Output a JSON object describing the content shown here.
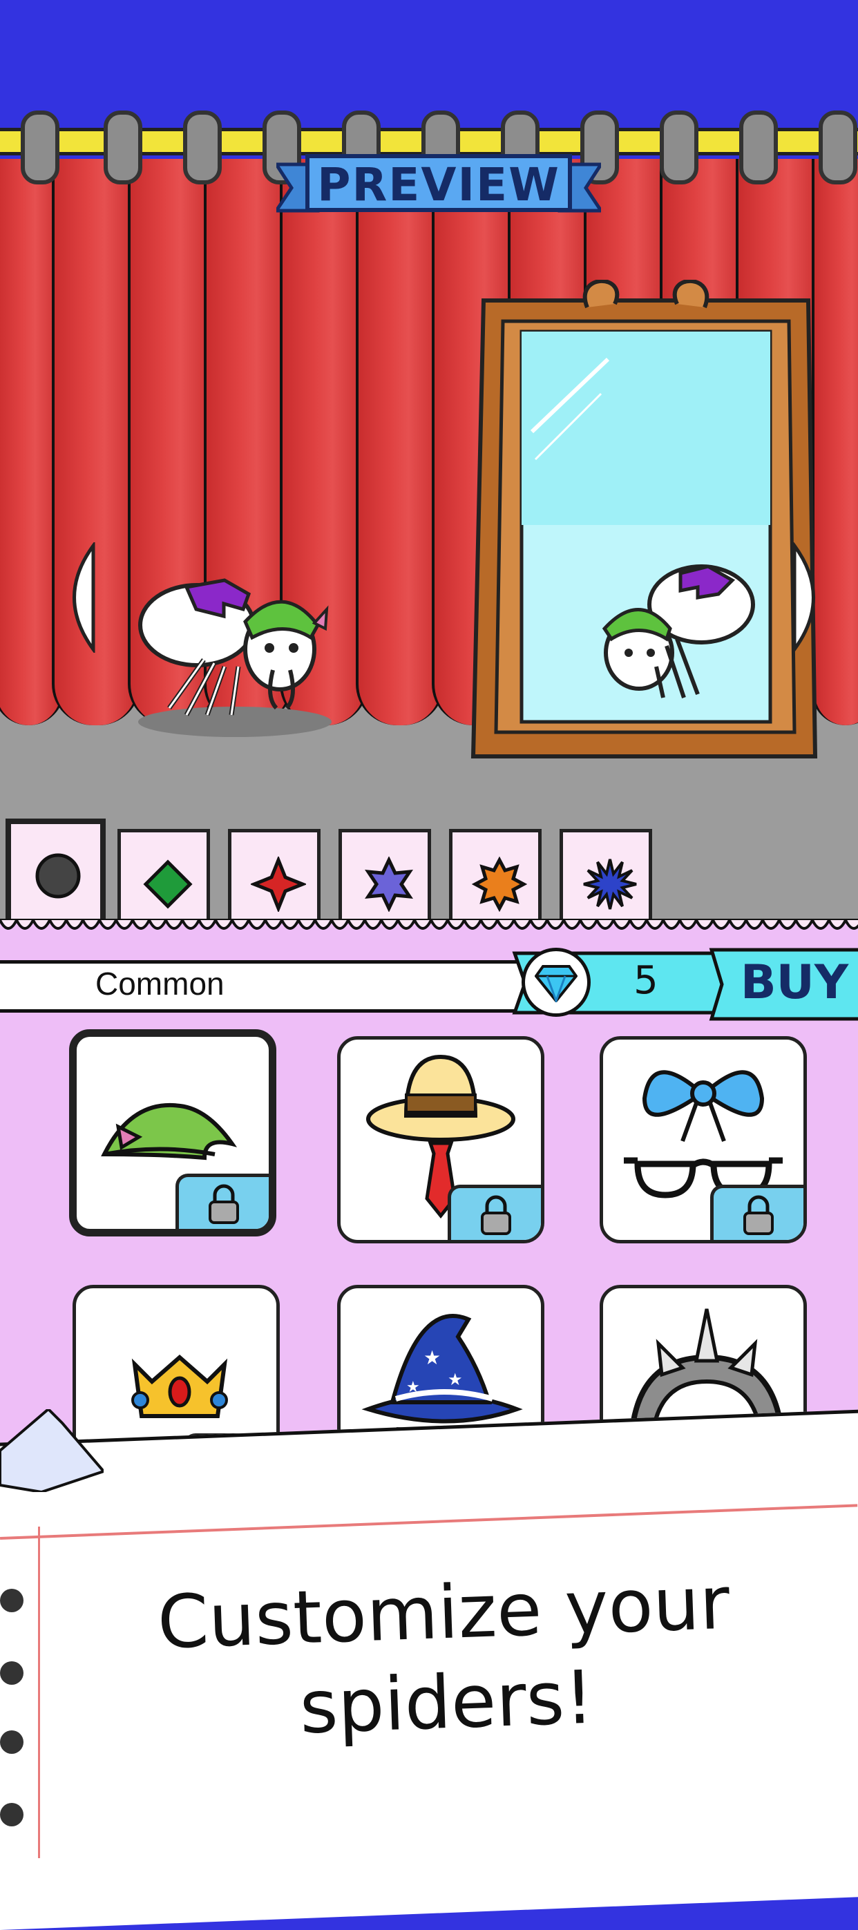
{
  "stage": {
    "banner_label": "PREVIEW",
    "prev_arrow_icon": "chevron-left-icon",
    "next_arrow_icon": "chevron-right-icon",
    "character": "spider-character",
    "mirror": "mirror-frame"
  },
  "rarity_tabs": [
    {
      "name": "common",
      "icon": "circle-icon",
      "color": "#444444"
    },
    {
      "name": "uncommon",
      "icon": "diamond-icon",
      "color": "#1f9b3a"
    },
    {
      "name": "rare",
      "icon": "four-point-star-icon",
      "color": "#d62525"
    },
    {
      "name": "epic",
      "icon": "six-point-star-icon",
      "color": "#6b63d8"
    },
    {
      "name": "legendary",
      "icon": "eight-point-star-icon",
      "color": "#ea7f1c"
    },
    {
      "name": "mythic",
      "icon": "twelve-point-star-icon",
      "color": "#2d43c9"
    }
  ],
  "shop": {
    "rarity_label": "Common",
    "currency_icon": "diamond-gem-icon",
    "price": "5",
    "buy_label": "BUY",
    "items": [
      {
        "name": "green-elf-hat",
        "locked": true,
        "selected": true
      },
      {
        "name": "straw-hat-with-tie",
        "locked": true,
        "selected": false
      },
      {
        "name": "blue-bow-with-glasses",
        "locked": true,
        "selected": false
      },
      {
        "name": "golden-crown",
        "locked": true,
        "selected": false
      },
      {
        "name": "wizard-hat-with-glasses",
        "locked": true,
        "selected": false
      },
      {
        "name": "spiked-helmet",
        "locked": false,
        "selected": false
      }
    ]
  },
  "caption": {
    "line1": "Customize your",
    "line2": "spiders!"
  },
  "colors": {
    "sky": "#3333e0",
    "curtain": "#e04242",
    "shop_background": "#eebef7",
    "ribbon": "#5ee6f0",
    "banner": "#5aa8f2"
  }
}
